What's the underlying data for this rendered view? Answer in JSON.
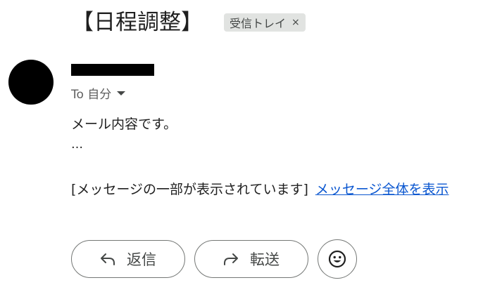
{
  "email": {
    "subject": "【日程調整】",
    "label": "受信トレイ",
    "label_remove": "×",
    "to_prefix": "To 自分",
    "body_line": "メール内容です。",
    "ellipsis": "…",
    "partial_notice": "[メッセージの一部が表示されています]",
    "show_all_link": "メッセージ全体を表示"
  },
  "actions": {
    "reply_label": "返信",
    "forward_label": "転送",
    "reply_icon": "reply-arrow-icon",
    "forward_icon": "forward-arrow-icon",
    "emoji_icon": "smiley-icon"
  },
  "colors": {
    "link": "#0b57d0",
    "chip_bg": "#e1e3e1",
    "avatar": "#000000"
  }
}
